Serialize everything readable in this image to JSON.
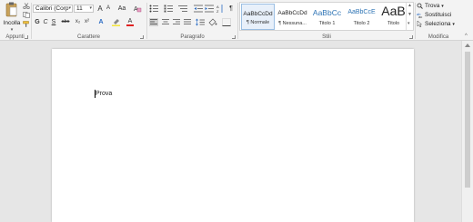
{
  "ribbon": {
    "clipboard": {
      "paste_label": "Incolla",
      "group_label": "Appunti"
    },
    "font": {
      "font_name": "Calibri (Corp",
      "font_size": "11",
      "grow_font": "A",
      "shrink_font": "A",
      "case_label": "Aa",
      "bold": "G",
      "italic": "C",
      "underline": "S",
      "strike": "abc",
      "subscript": "x₂",
      "superscript": "x²",
      "text_effects": "A",
      "font_color": "A",
      "group_label": "Carattere"
    },
    "paragraph": {
      "group_label": "Paragrafo"
    },
    "styles": {
      "items": [
        {
          "sample": "AaBbCcDd",
          "name": "¶ Normale",
          "active": true
        },
        {
          "sample": "AaBbCcDd",
          "name": "¶ Nessuna...",
          "active": false
        },
        {
          "sample": "AaBbCc",
          "name": "Titolo 1",
          "active": false
        },
        {
          "sample": "AaBbCcE",
          "name": "Titolo 2",
          "active": false
        },
        {
          "sample": "AaB",
          "name": "Titolo",
          "active": false
        }
      ],
      "group_label": "Stili"
    },
    "editing": {
      "find": "Trova",
      "replace": "Sostituisci",
      "select": "Seleziona",
      "group_label": "Modifica"
    }
  },
  "document": {
    "text": "Prova"
  },
  "colors": {
    "highlight": "#f5e53a",
    "font_color": "#e02020",
    "heading_blue": "#2e74b5",
    "accent": "#2b579a"
  }
}
